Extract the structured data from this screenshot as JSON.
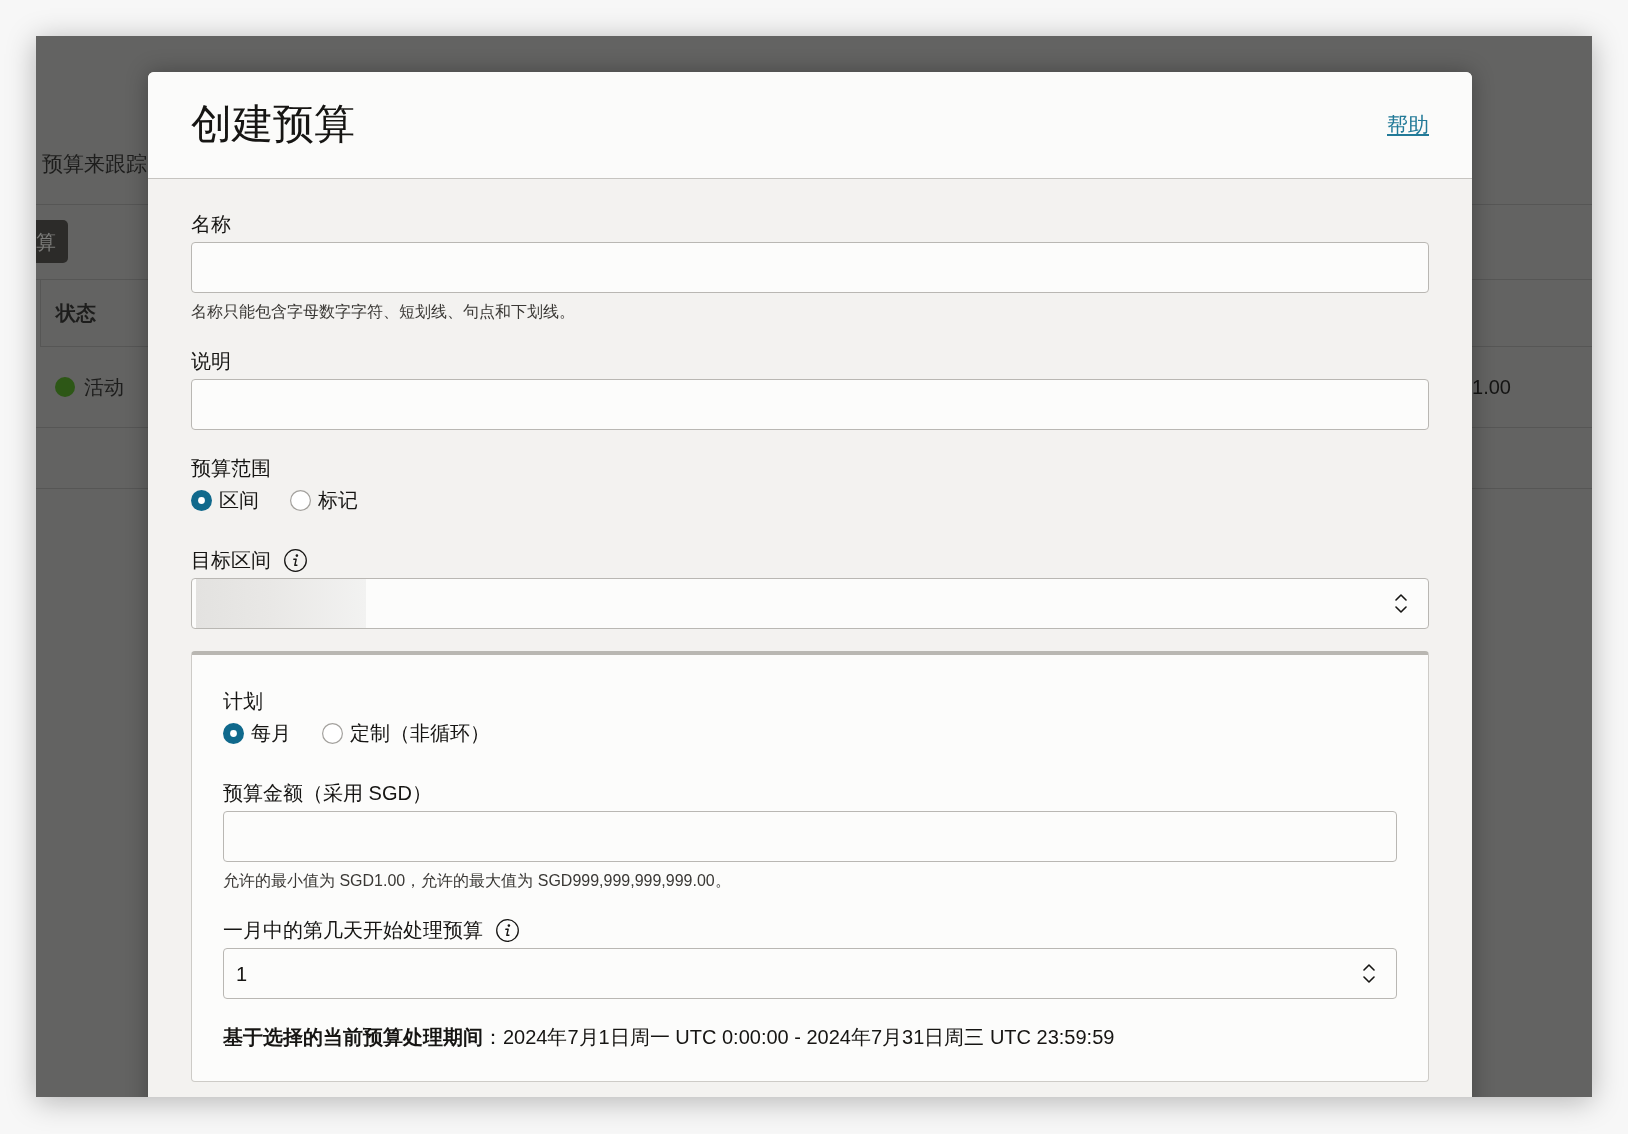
{
  "background_page": {
    "description": "预算来跟踪",
    "button": "算",
    "table": {
      "columns": [
        "状态"
      ],
      "rows": [
        {
          "status": {
            "label": "活动",
            "color": "#2d5716"
          },
          "column_2": "1.00"
        }
      ]
    }
  },
  "dialog": {
    "title": "创建预算",
    "help_link": "帮助",
    "fields": [
      {
        "kind": "text",
        "label": "名称",
        "hint": "名称只能包含字母数字字符、短划线、句点和下划线。"
      },
      {
        "kind": "text",
        "label": "说明"
      },
      {
        "kind": "radio",
        "label": "预算范围",
        "options": [
          {
            "label": "区间",
            "selected": true
          },
          {
            "label": "标记",
            "selected": false
          }
        ]
      },
      {
        "kind": "select",
        "label": "目标区间",
        "info": true,
        "redacted": true
      },
      {
        "kind": "panel",
        "fields": [
          {
            "kind": "radio",
            "label": "计划",
            "options": [
              {
                "label": "每月",
                "selected": true
              },
              {
                "label": "定制（非循环）",
                "selected": false
              }
            ]
          },
          {
            "kind": "text",
            "label": "预算金额（采用 SGD）",
            "hint": "允许的最小值为 SGD1.00，允许的最大值为 SGD999,999,999,999.00。"
          },
          {
            "kind": "select",
            "label": "一月中的第几天开始处理预算",
            "info": true,
            "value": "1"
          },
          {
            "kind": "summary",
            "text": "**基于选择的当前预算处理期间**：2024年7月1日周一 UTC 0:00:00 - 2024年7月31日周三 UTC 23:59:59"
          }
        ]
      }
    ]
  }
}
